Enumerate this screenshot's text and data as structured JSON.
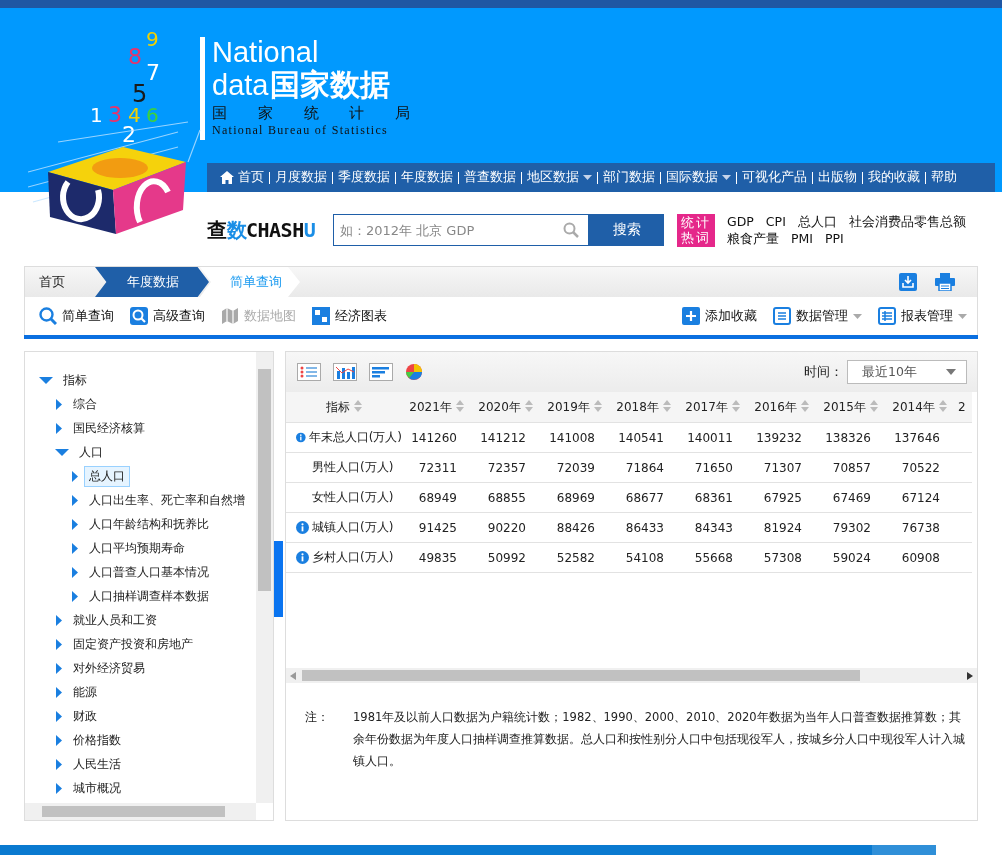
{
  "header": {
    "logo_digits": [
      {
        "text": "9",
        "color": "#f2d100"
      },
      {
        "text": "8",
        "color": "#e8336b"
      },
      {
        "text": "7",
        "color": "#ffffff"
      },
      {
        "text": "5",
        "color": "#1a1a1a"
      },
      {
        "text": "1",
        "color": "#ffffff"
      },
      {
        "text": "3",
        "color": "#e8336b"
      },
      {
        "text": "4",
        "color": "#f2d100"
      },
      {
        "text": "6",
        "color": "#3dd13d"
      },
      {
        "text": "2",
        "color": "#ffffff"
      }
    ],
    "title_en": "National",
    "title_line2_en": "data",
    "title_cn": "国家数据",
    "bureau_cn": "国 家 统 计 局",
    "bureau_en": "National Bureau of Statistics"
  },
  "nav": [
    {
      "label": "首页",
      "kind": "home"
    },
    {
      "label": "月度数据",
      "kind": "link"
    },
    {
      "label": "季度数据",
      "kind": "link"
    },
    {
      "label": "年度数据",
      "kind": "link"
    },
    {
      "label": "普查数据",
      "kind": "link"
    },
    {
      "label": "地区数据",
      "kind": "menu"
    },
    {
      "label": "部门数据",
      "kind": "link"
    },
    {
      "label": "国际数据",
      "kind": "menu"
    },
    {
      "label": "可视化产品",
      "kind": "link"
    },
    {
      "label": "出版物",
      "kind": "link"
    },
    {
      "label": "我的收藏",
      "kind": "link"
    },
    {
      "label": "帮助",
      "kind": "link"
    }
  ],
  "search": {
    "brand": [
      {
        "text": "查",
        "color": "#111111"
      },
      {
        "text": "数",
        "color": "#1a8ee6"
      },
      {
        "text": "CHASH",
        "color": "#111111"
      },
      {
        "text": "U",
        "color": "#1a8ee6"
      }
    ],
    "placeholder": "如：2012年 北京 GDP",
    "button": "搜索",
    "hot_label": [
      "统计",
      "热词"
    ],
    "hot_words": [
      "GDP",
      "CPI",
      "总人口",
      "社会消费品零售总额",
      "粮食产量",
      "PMI",
      "PPI"
    ]
  },
  "breadcrumb": [
    {
      "label": "首页",
      "kind": "home"
    },
    {
      "label": "年度数据",
      "kind": "section"
    },
    {
      "label": "简单查询",
      "kind": "current"
    }
  ],
  "toolbar": {
    "left": [
      {
        "label": "简单查询",
        "kind": "search",
        "disabled": false
      },
      {
        "label": "高级查询",
        "kind": "search-box",
        "disabled": false
      },
      {
        "label": "数据地图",
        "kind": "map",
        "disabled": true
      },
      {
        "label": "经济图表",
        "kind": "chart",
        "disabled": false
      }
    ],
    "right": [
      {
        "label": "添加收藏",
        "kind": "add",
        "dropdown": false
      },
      {
        "label": "数据管理",
        "kind": "list",
        "dropdown": true
      },
      {
        "label": "报表管理",
        "kind": "table",
        "dropdown": true
      }
    ]
  },
  "tree": [
    {
      "label": "指标",
      "expanded": true,
      "selected": false,
      "children": [
        {
          "label": "综合",
          "expanded": false,
          "selected": false
        },
        {
          "label": "国民经济核算",
          "expanded": false,
          "selected": false
        },
        {
          "label": "人口",
          "expanded": true,
          "selected": false,
          "children": [
            {
              "label": "总人口",
              "expanded": false,
              "selected": true
            },
            {
              "label": "人口出生率、死亡率和自然增",
              "expanded": false,
              "selected": false
            },
            {
              "label": "人口年龄结构和抚养比",
              "expanded": false,
              "selected": false
            },
            {
              "label": "人口平均预期寿命",
              "expanded": false,
              "selected": false
            },
            {
              "label": "人口普查人口基本情况",
              "expanded": false,
              "selected": false
            },
            {
              "label": "人口抽样调查样本数据",
              "expanded": false,
              "selected": false
            }
          ]
        },
        {
          "label": "就业人员和工资",
          "expanded": false,
          "selected": false
        },
        {
          "label": "固定资产投资和房地产",
          "expanded": false,
          "selected": false
        },
        {
          "label": "对外经济贸易",
          "expanded": false,
          "selected": false
        },
        {
          "label": "能源",
          "expanded": false,
          "selected": false
        },
        {
          "label": "财政",
          "expanded": false,
          "selected": false
        },
        {
          "label": "价格指数",
          "expanded": false,
          "selected": false
        },
        {
          "label": "人民生活",
          "expanded": false,
          "selected": false
        },
        {
          "label": "城市概况",
          "expanded": false,
          "selected": false
        }
      ]
    }
  ],
  "table": {
    "time_label": "时间：",
    "time_value": "最近10年",
    "columns": [
      "指标",
      "2021年",
      "2020年",
      "2019年",
      "2018年",
      "2017年",
      "2016年",
      "2015年",
      "2014年",
      "2"
    ],
    "rows": [
      {
        "label": "年末总人口(万人)",
        "info": true,
        "values": [
          "141260",
          "141212",
          "141008",
          "140541",
          "140011",
          "139232",
          "138326",
          "137646"
        ]
      },
      {
        "label": "男性人口(万人)",
        "info": false,
        "values": [
          "72311",
          "72357",
          "72039",
          "71864",
          "71650",
          "71307",
          "70857",
          "70522"
        ]
      },
      {
        "label": "女性人口(万人)",
        "info": false,
        "values": [
          "68949",
          "68855",
          "68969",
          "68677",
          "68361",
          "67925",
          "67469",
          "67124"
        ]
      },
      {
        "label": "城镇人口(万人)",
        "info": true,
        "values": [
          "91425",
          "90220",
          "88426",
          "86433",
          "84343",
          "81924",
          "79302",
          "76738"
        ]
      },
      {
        "label": "乡村人口(万人)",
        "info": true,
        "values": [
          "49835",
          "50992",
          "52582",
          "54108",
          "55668",
          "57308",
          "59024",
          "60908"
        ]
      }
    ]
  },
  "note": {
    "label": "注：",
    "text": "1981年及以前人口数据为户籍统计数；1982、1990、2000、2010、2020年数据为当年人口普查数据推算数；其余年份数据为年度人口抽样调查推算数据。总人口和按性别分人口中包括现役军人，按城乡分人口中现役军人计入城镇人口。"
  }
}
